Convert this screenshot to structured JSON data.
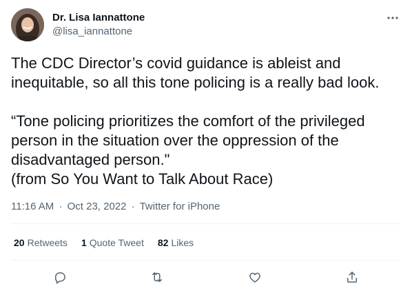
{
  "author": {
    "display_name": "Dr. Lisa Iannattone",
    "handle": "@lisa_iannattone"
  },
  "tweet": {
    "text": "The CDC Director’s covid guidance is ableist and\ninequitable, so all this tone policing is a really bad look.\n\n“Tone policing prioritizes the comfort of the privileged\nperson in the situation over the oppression of the\ndisadvantaged person.\"\n(from So You Want to Talk About Race)",
    "time": "11:16 AM",
    "separator": "·",
    "date": "Oct 23, 2022",
    "source": "Twitter for iPhone"
  },
  "stats": {
    "retweets_count": "20",
    "retweets_label": "Retweets",
    "quotes_count": "1",
    "quotes_label": "Quote Tweet",
    "likes_count": "82",
    "likes_label": "Likes"
  },
  "actions": [
    "reply-icon",
    "retweet-icon",
    "like-icon",
    "share-icon"
  ],
  "colors": {
    "text_primary": "#0f1419",
    "text_secondary": "#536471",
    "divider": "#eff3f4"
  }
}
